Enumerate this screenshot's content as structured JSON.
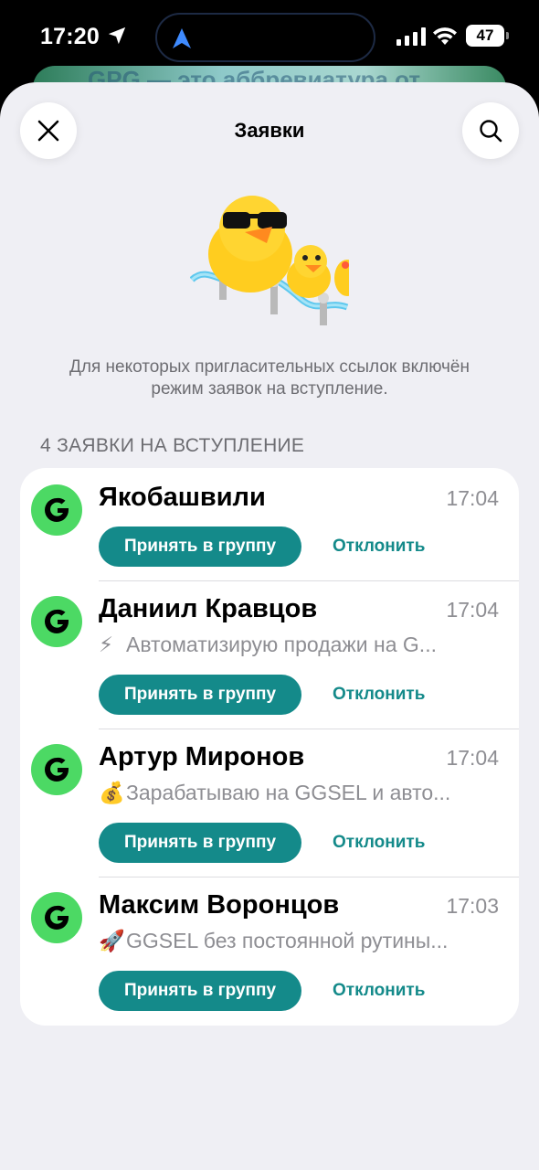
{
  "status_bar": {
    "time": "17:20",
    "battery": "47"
  },
  "background_sheet": {
    "peek_text": "GPG — это аббревиатура от"
  },
  "header": {
    "title": "Заявки"
  },
  "info": {
    "text": "Для некоторых пригласительных ссылок включён режим заявок на вступление."
  },
  "requests": {
    "header": "4 ЗАЯВКИ НА ВСТУПЛЕНИЕ",
    "items": [
      {
        "name": "Якобашвили",
        "time": "17:04",
        "bio_emoji": "",
        "bio": "",
        "accept_label": "Принять в группу",
        "decline_label": "Отклонить"
      },
      {
        "name": "Даниил Кравцов",
        "time": "17:04",
        "bio_emoji": "⚡",
        "bio": "Автоматизирую продажи на G...",
        "accept_label": "Принять в группу",
        "decline_label": "Отклонить"
      },
      {
        "name": "Артур Миронов",
        "time": "17:04",
        "bio_emoji": "💰",
        "bio": "Зарабатываю на GGSEL и авто...",
        "accept_label": "Принять в группу",
        "decline_label": "Отклонить"
      },
      {
        "name": "Максим Воронцов",
        "time": "17:03",
        "bio_emoji": "🚀",
        "bio": "GGSEL без постоянной рутины...",
        "accept_label": "Принять в группу",
        "decline_label": "Отклонить"
      }
    ]
  },
  "colors": {
    "accent": "#148a8a",
    "avatar_green": "#4cd964",
    "sheet_background": "#efeff4"
  },
  "icons": {
    "close": "close-icon",
    "search": "search-icon",
    "avatar_logo": "ggsel-logo-icon"
  }
}
